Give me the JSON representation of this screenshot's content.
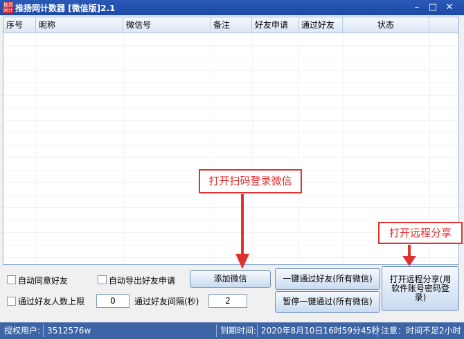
{
  "window": {
    "title": "推扬网计数器 [微信版]2.1",
    "icon_text": "推扬网计数器",
    "minimize": "–",
    "maximize": "□",
    "close": "✕"
  },
  "table": {
    "columns": [
      "序号",
      "昵称",
      "微信号",
      "备注",
      "好友申请",
      "通过好友",
      "状态"
    ],
    "rows": []
  },
  "controls": {
    "auto_accept_label": "自动同意好友",
    "auto_export_label": "自动导出好友申请",
    "limit_label": "通过好友人数上限",
    "limit_value": "0",
    "interval_label": "通过好友间隔(秒)",
    "interval_value": "2",
    "add_wechat_button": "添加微信",
    "pass_all_button": "一键通过好友(所有微信)",
    "pause_all_button": "暂停一键通过(所有微信)",
    "remote_share_button": "打开远程分享(用软件账号密码登录)"
  },
  "callouts": {
    "scan_login": "打开扫码登录微信",
    "remote_share": "打开远程分享"
  },
  "status_bar": {
    "licensed_user_label": "授权用户:",
    "licensed_user_value": "3512576w",
    "expiry_label": "到期时间:",
    "expiry_value": "2020年8月10日16时59分45秒",
    "notice": "注意：时间不足2小时"
  },
  "colors": {
    "title_bar": "#1d48a6",
    "status_bar": "#3d64a5",
    "callout": "#e03030"
  }
}
